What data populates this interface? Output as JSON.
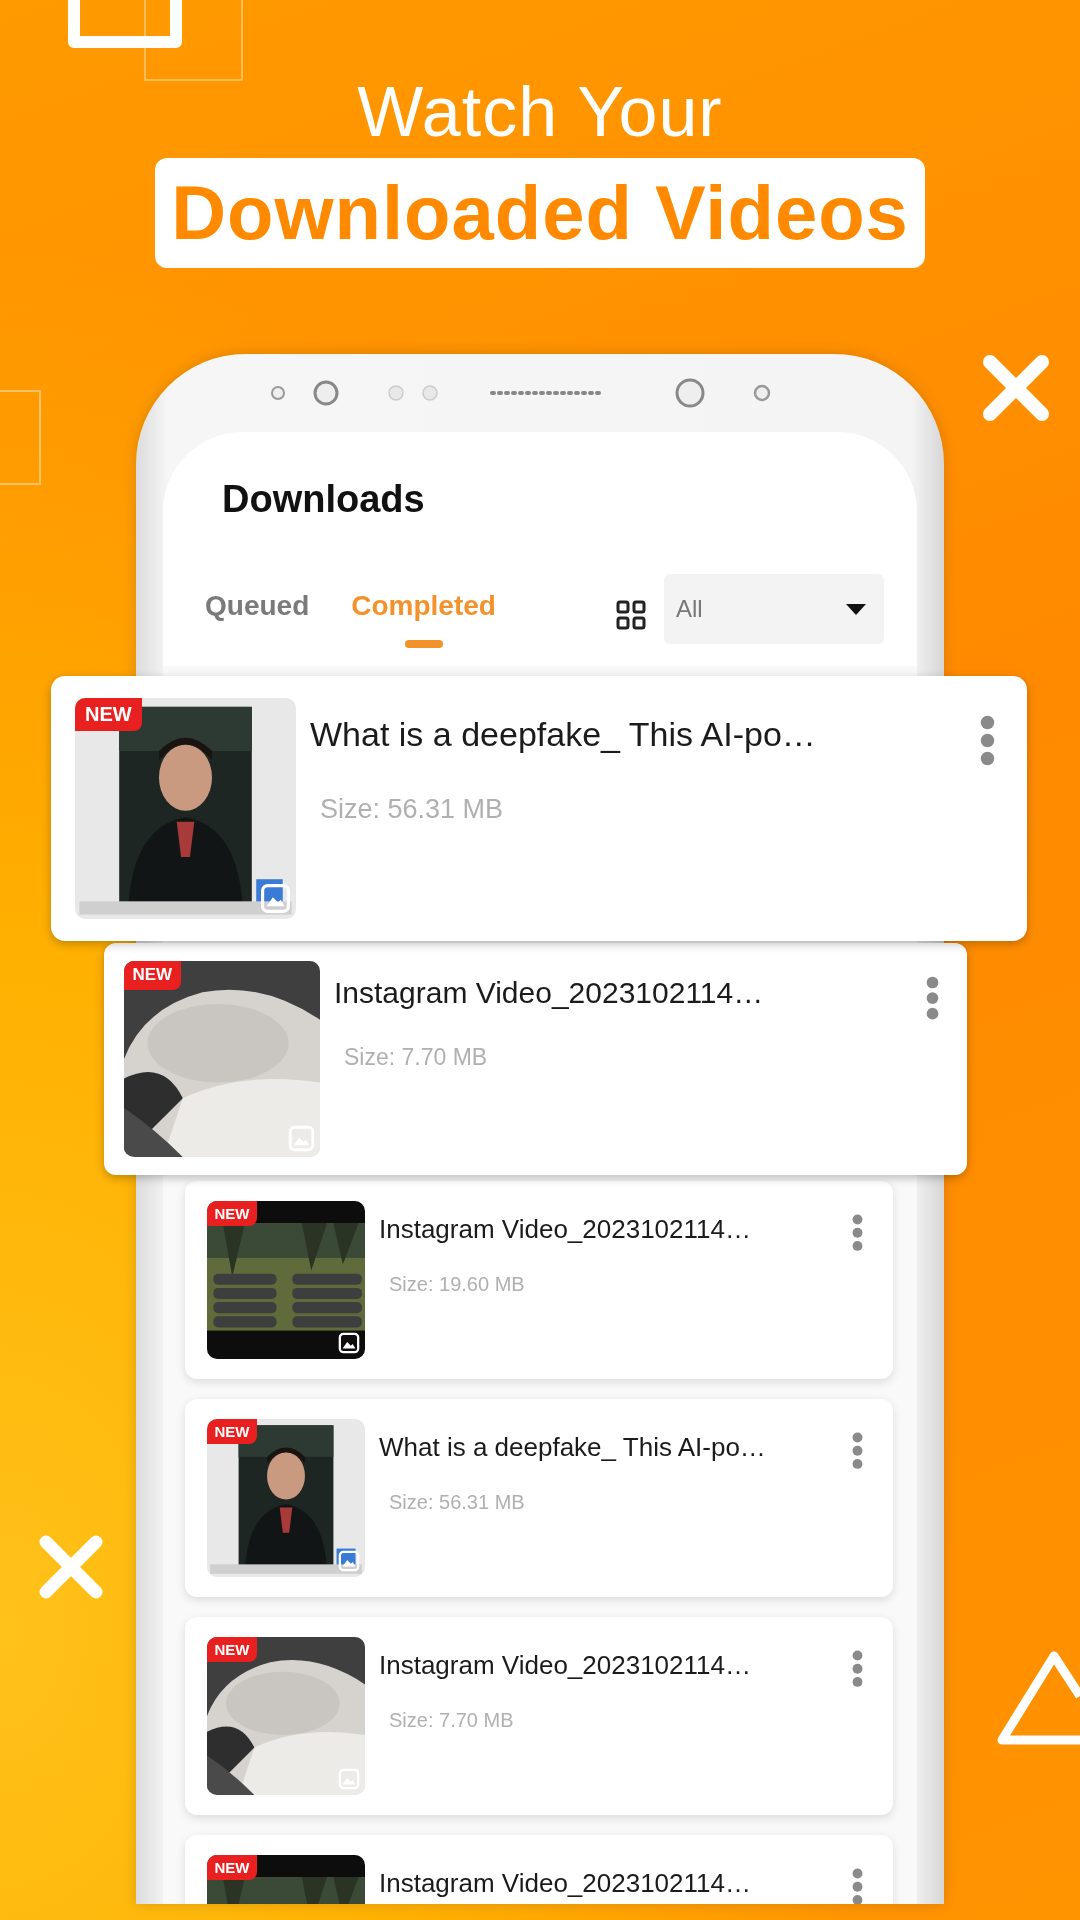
{
  "headline": {
    "line_1": "Watch Your",
    "line_2": "Downloaded Videos"
  },
  "screen": {
    "title": "Downloads",
    "tabs": [
      {
        "label": "Queued",
        "selected": false
      },
      {
        "label": "Completed",
        "selected": true
      }
    ],
    "filter": {
      "value": "All"
    }
  },
  "videos": [
    {
      "kind": "hero",
      "badge": "NEW",
      "title": "What is a deepfake_ This AI-po…",
      "size": "Size: 56.31 MB"
    },
    {
      "kind": "raised",
      "badge": "NEW",
      "title": "Instagram Video_2023102114…",
      "size": "Size: 7.70 MB"
    },
    {
      "kind": "plain",
      "badge": "NEW",
      "title": "Instagram Video_2023102114…",
      "size": "Size: 19.60 MB"
    },
    {
      "kind": "plain",
      "badge": "NEW",
      "title": "What is a deepfake_ This AI-po…",
      "size": "Size: 56.31 MB"
    },
    {
      "kind": "plain",
      "badge": "NEW",
      "title": "Instagram Video_2023102114…",
      "size": "Size: 7.70 MB"
    },
    {
      "kind": "plain",
      "badge": "NEW",
      "title": "Instagram Video_2023102114…"
    }
  ]
}
